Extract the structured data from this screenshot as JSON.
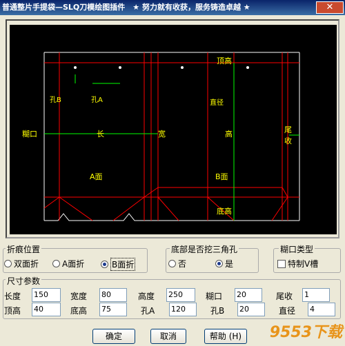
{
  "window": {
    "title": "普通整片手提袋—SLQ刀模绘图插件　★ 努力就有收获，服务铸造卓越 ★",
    "close_symbol": "✕"
  },
  "diagram": {
    "labels": {
      "hole_b": "孔B",
      "hole_a": "孔A",
      "top_height": "顶高",
      "diameter": "直径",
      "glue_flap": "糊口",
      "length": "长",
      "width": "宽",
      "height": "高",
      "tail": "尾收",
      "face_a": "A面",
      "face_b": "B面",
      "bottom_height": "底高"
    }
  },
  "crease": {
    "title": "折痕位置",
    "options": [
      "双面折",
      "A面折",
      "B面折"
    ],
    "selected": "B面折"
  },
  "bottom_triangle": {
    "title": "底部是否挖三角孔",
    "options": [
      "否",
      "是"
    ],
    "selected": "是"
  },
  "glue_type": {
    "title": "糊口类型",
    "checkbox_label": "特制V槽"
  },
  "params": {
    "title": "尺寸参数",
    "row1": [
      {
        "label": "长度",
        "value": "150"
      },
      {
        "label": "宽度",
        "value": "80"
      },
      {
        "label": "高度",
        "value": "250"
      },
      {
        "label": "糊口",
        "value": "20"
      },
      {
        "label": "尾收",
        "value": "1"
      }
    ],
    "row2": [
      {
        "label": "顶高",
        "value": "40"
      },
      {
        "label": "底高",
        "value": "75"
      },
      {
        "label": "孔A",
        "value": "120"
      },
      {
        "label": "孔B",
        "value": "20"
      },
      {
        "label": "直径",
        "value": "4"
      }
    ]
  },
  "buttons": {
    "ok": "确定",
    "cancel": "取消",
    "help": "帮助 (H)"
  },
  "watermark": "9553下载",
  "colors": {
    "outline": "#ffffff",
    "crease": "#ff0000",
    "dimension": "#00ff00",
    "label": "#ffff00"
  }
}
